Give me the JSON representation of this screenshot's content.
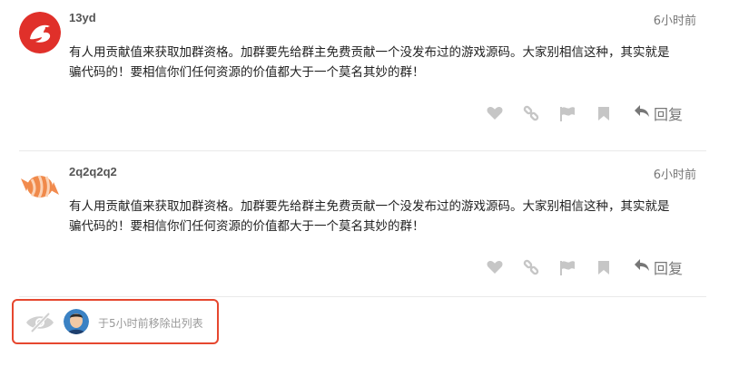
{
  "posts": [
    {
      "author": "13yd",
      "time": "6小时前",
      "text_line1": "有人用贡献值来获取加群资格。加群要先给群主免费贡献一个没发布过的游戏源码。大家别相信这种，其实就是",
      "text_line2": "骗代码的！要相信你们任何资源的价值都大于一个莫名其妙的群！",
      "reply_label": "回复"
    },
    {
      "author": "2q2q2q2",
      "time": "6小时前",
      "text_line1": "有人用贡献值来获取加群资格。加群要先给群主免费贡献一个没发布过的游戏源码。大家别相信这种，其实就是",
      "text_line2": "骗代码的！要相信你们任何资源的价值都大于一个莫名其妙的群！",
      "reply_label": "回复"
    }
  ],
  "notice": {
    "text": "于5小时前移除出列表"
  },
  "icons": {
    "like": "heart-icon",
    "link": "link-icon",
    "flag": "flag-icon",
    "bookmark": "bookmark-icon",
    "reply": "reply-arrow-icon",
    "unlisted": "eye-slash-icon"
  },
  "colors": {
    "highlight_border": "#e6472f",
    "avatar1": "#e0302a",
    "avatar2": "#f08a4b"
  }
}
